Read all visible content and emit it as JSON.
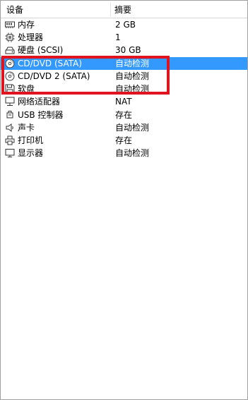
{
  "table": {
    "header": {
      "device": "设备",
      "summary": "摘要"
    },
    "rows": [
      {
        "name": "内存",
        "summary": "2 GB",
        "icon": "memory-icon"
      },
      {
        "name": "处理器",
        "summary": "1",
        "icon": "cpu-icon"
      },
      {
        "name": "硬盘 (SCSI)",
        "summary": "30 GB",
        "icon": "hard-disk-icon"
      },
      {
        "name": "CD/DVD (SATA)",
        "summary": "自动检测",
        "icon": "cd-dvd-icon",
        "selected": true
      },
      {
        "name": "CD/DVD 2 (SATA)",
        "summary": "自动检测",
        "icon": "cd-dvd-icon"
      },
      {
        "name": "软盘",
        "summary": "自动检测",
        "icon": "floppy-icon"
      },
      {
        "name": "网络适配器",
        "summary": "NAT",
        "icon": "network-adapter-icon"
      },
      {
        "name": "USB 控制器",
        "summary": "存在",
        "icon": "usb-icon"
      },
      {
        "name": "声卡",
        "summary": "自动检测",
        "icon": "sound-card-icon"
      },
      {
        "name": "打印机",
        "summary": "存在",
        "icon": "printer-icon"
      },
      {
        "name": "显示器",
        "summary": "自动检测",
        "icon": "display-icon"
      }
    ]
  },
  "colors": {
    "selection": "#3399ff",
    "highlight_box": "#e0141e"
  }
}
